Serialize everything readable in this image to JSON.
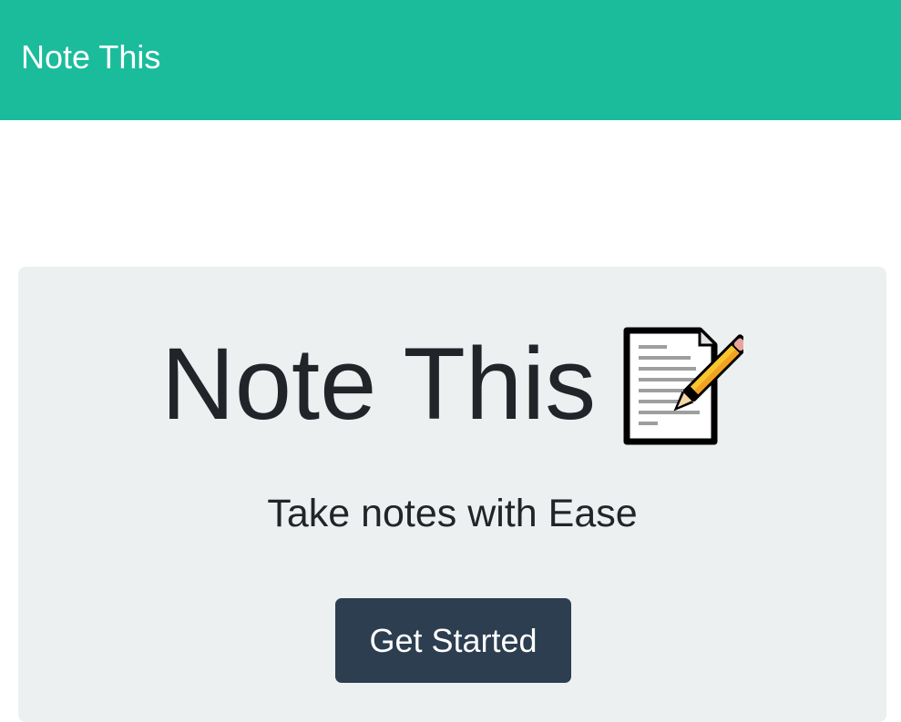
{
  "navbar": {
    "brand": "Note This",
    "color": "#1abc9c"
  },
  "hero": {
    "title": "Note This",
    "icon": "memo-pencil-icon",
    "subtitle": "Take notes with Ease",
    "cta_label": "Get Started",
    "background": "#ecf0f1",
    "cta_color": "#2c3e50"
  }
}
